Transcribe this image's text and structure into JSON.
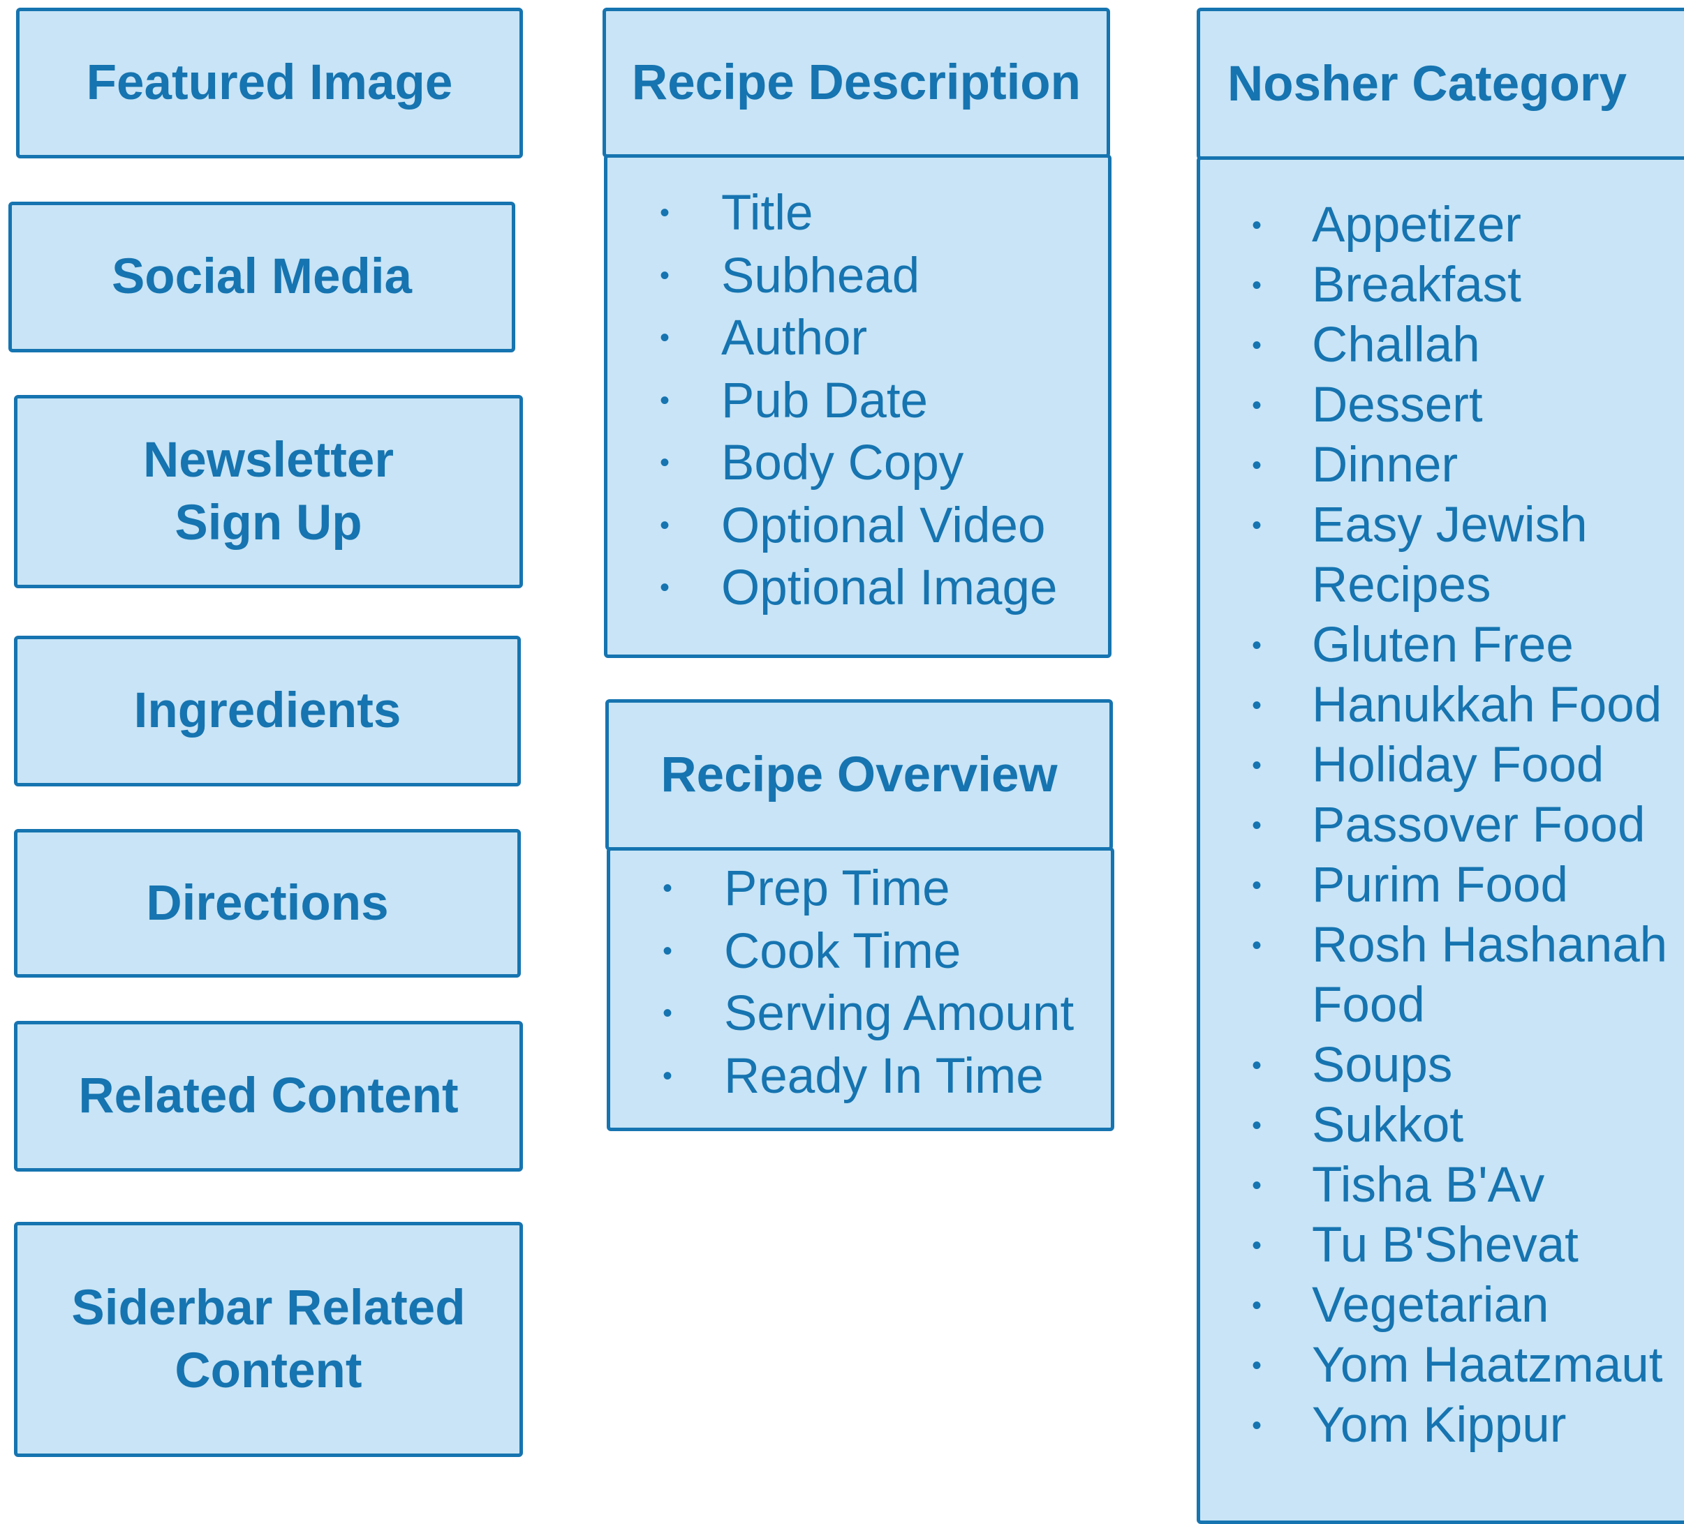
{
  "left_column": {
    "featured_image": "Featured Image",
    "social_media": "Social Media",
    "newsletter_line1": "Newsletter",
    "newsletter_line2": "Sign Up",
    "ingredients": "Ingredients",
    "directions": "Directions",
    "related_content": "Related Content",
    "sidebar_line1": "Siderbar Related",
    "sidebar_line2": "Content"
  },
  "recipe_description": {
    "title": "Recipe Description",
    "items": [
      "Title",
      "Subhead",
      "Author",
      "Pub Date",
      "Body Copy",
      "Optional Video",
      "Optional Image"
    ]
  },
  "recipe_overview": {
    "title": "Recipe Overview",
    "items": [
      "Prep Time",
      "Cook Time",
      "Serving Amount",
      "Ready In Time"
    ]
  },
  "nosher_category": {
    "title": "Nosher Category",
    "items": [
      [
        "Appetizer"
      ],
      [
        "Breakfast"
      ],
      [
        "Challah"
      ],
      [
        "Dessert"
      ],
      [
        "Dinner"
      ],
      [
        "Easy Jewish",
        "Recipes"
      ],
      [
        "Gluten Free"
      ],
      [
        "Hanukkah Food"
      ],
      [
        "Holiday Food"
      ],
      [
        "Passover Food"
      ],
      [
        "Purim Food"
      ],
      [
        "Rosh Hashanah",
        "Food"
      ],
      [
        "Soups"
      ],
      [
        "Sukkot"
      ],
      [
        "Tisha B'Av"
      ],
      [
        "Tu B'Shevat"
      ],
      [
        "Vegetarian"
      ],
      [
        "Yom Haatzmaut"
      ],
      [
        "Yom Kippur"
      ]
    ]
  },
  "colors": {
    "fill": "#c8e4f6",
    "stroke": "#1674b0",
    "text": "#1674b0",
    "background": "#ffffff"
  }
}
